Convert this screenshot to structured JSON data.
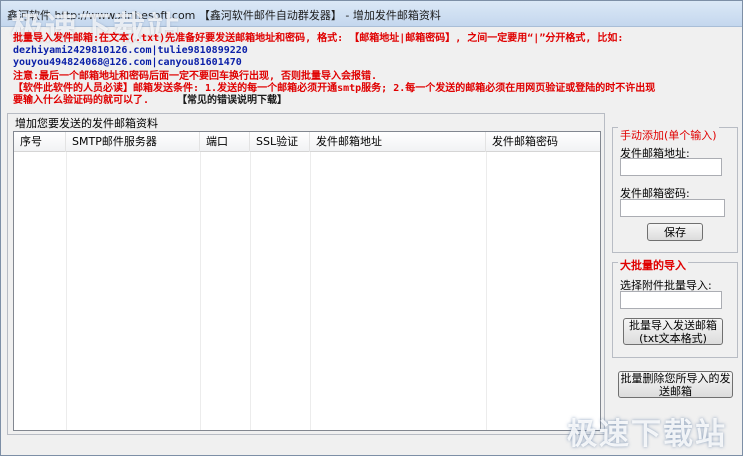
{
  "window": {
    "title": "鑫河软件 http://www.xinhesoft.com 【鑫河软件邮件自动群发器】 - 增加发件邮箱资料"
  },
  "watermark": {
    "top": "极速下载站",
    "bottom": "极速下载站"
  },
  "notice": {
    "line1": "批量导入发件邮箱:在文本(.txt)先准备好要发送邮箱地址和密码, 格式: 【邮箱地址|邮箱密码】, 之间一定要用“|”分开格式, 比如:",
    "line2": "dezhiyami2429810126.com|tulie9810899220",
    "line3": "youyou494824068@126.com|canyou81601470",
    "line4": "注意:最后一个邮箱地址和密码后面一定不要回车换行出现, 否则批量导入会报错.",
    "line5": "【软件此软件的人员必读】邮箱发送条件: 1.发送的每一个邮箱必须开通smtp服务; 2.每一个发送的邮箱必须在用网页验证或登陆的时不许出现",
    "line6a": "要输入什么验证码的就可以了.",
    "line6b": "【常见的错误说明下载】"
  },
  "main_group": {
    "title": "增加您要发送的发件邮箱资料",
    "columns": [
      "序号",
      "SMTP邮件服务器",
      "端口",
      "SSL验证",
      "发件邮箱地址",
      "发件邮箱密码"
    ]
  },
  "manual_add": {
    "title": "手动添加(单个输入)",
    "email_label": "发件邮箱地址:",
    "email_value": "",
    "password_label": "发件邮箱密码:",
    "password_value": "",
    "save_label": "保存"
  },
  "batch_import": {
    "title": "大批量的导入",
    "select_label": "选择附件批量导入:",
    "file_value": "",
    "import_button_line1": "批量导入发送邮箱",
    "import_button_line2": "(txt文本格式)"
  },
  "batch_delete": {
    "button_line1": "批量删除您所导入的发",
    "button_line2": "送邮箱"
  }
}
